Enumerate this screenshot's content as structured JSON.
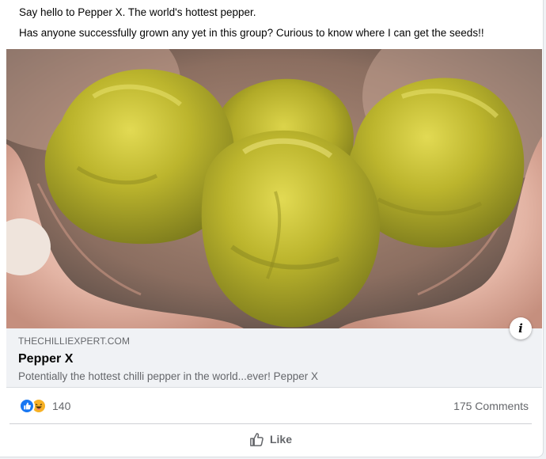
{
  "post": {
    "line1": "Say hello to Pepper X. The world's hottest pepper.",
    "line2": "Has anyone successfully grown any yet in this group? Curious to know where I can get the seeds!!"
  },
  "link_preview": {
    "image_subject": "hands holding green peppers",
    "info_label": "i",
    "domain": "THECHILLIEXPERT.COM",
    "title": "Pepper X",
    "description": "Potentially the hottest chilli pepper in the world...ever! Pepper X"
  },
  "reactions": {
    "types": [
      "like-icon",
      "haha-icon"
    ],
    "count": "140",
    "comments": "175 Comments"
  },
  "actions": {
    "like_label": "Like"
  },
  "colors": {
    "accent": "#1877f2",
    "secondary_text": "#65676b",
    "pepper": "#b8b42a"
  }
}
